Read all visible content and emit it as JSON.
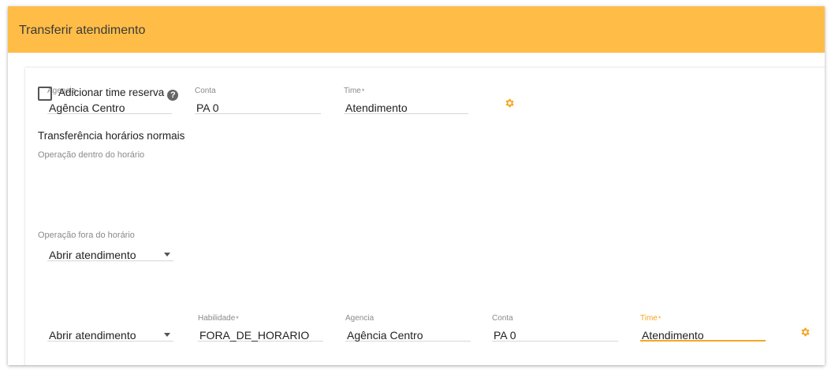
{
  "header": {
    "title": "Transferir atendimento"
  },
  "top_fields": {
    "agencia": {
      "label": "Agencia",
      "value": "Agência Centro"
    },
    "conta": {
      "label": "Conta",
      "value": "PA 0"
    },
    "time": {
      "label": "Time",
      "required": "*",
      "value": "Atendimento"
    }
  },
  "reserve": {
    "label": "Adicionar time reserva",
    "help_icon": "help-circle-icon",
    "checked": false
  },
  "section": {
    "title": "Transferência horários normais",
    "inside": {
      "label": "Operação dentro do horário",
      "value": "Abrir atendimento"
    },
    "outside": {
      "label": "Operação fora do horário",
      "value": "Abrir atendimento"
    }
  },
  "bottom_fields": {
    "habilidade": {
      "label": "Habilidade",
      "required": "*",
      "value": "FORA_DE_HORARIO"
    },
    "agencia": {
      "label": "Agencia",
      "value": "Agência Centro"
    },
    "conta": {
      "label": "Conta",
      "value": "PA 0"
    },
    "time": {
      "label": "Time",
      "required": "*",
      "value": "Atendimento"
    }
  },
  "colors": {
    "header": "#ffbd48",
    "accent": "#f5a623"
  }
}
